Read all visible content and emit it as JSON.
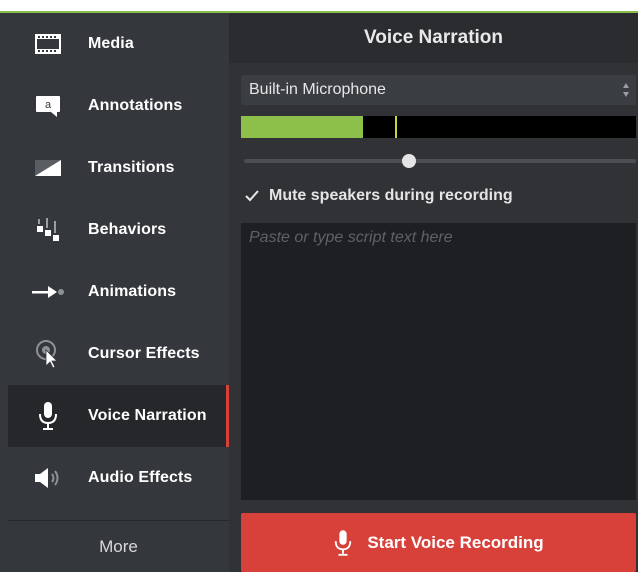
{
  "sidebar": {
    "items": [
      {
        "label": "Media",
        "icon": "film-strip-icon"
      },
      {
        "label": "Annotations",
        "icon": "speech-bubble-icon"
      },
      {
        "label": "Transitions",
        "icon": "transition-icon"
      },
      {
        "label": "Behaviors",
        "icon": "behaviors-icon"
      },
      {
        "label": "Animations",
        "icon": "arrow-animation-icon"
      },
      {
        "label": "Cursor Effects",
        "icon": "cursor-effects-icon"
      },
      {
        "label": "Voice Narration",
        "icon": "microphone-icon",
        "active": true
      },
      {
        "label": "Audio Effects",
        "icon": "speaker-icon"
      }
    ],
    "more_label": "More"
  },
  "panel": {
    "title": "Voice Narration",
    "device": {
      "selected": "Built-in Microphone"
    },
    "level_meter": {
      "level": 0.31,
      "peak": 0.39,
      "color": "#8dc04b"
    },
    "volume": {
      "value": 0.42
    },
    "mute_speakers": {
      "label": "Mute speakers during recording",
      "checked": true
    },
    "script": {
      "value": "",
      "placeholder": "Paste or type script text here"
    },
    "record_button": {
      "label": "Start Voice Recording",
      "color": "#d8403a"
    }
  },
  "colors": {
    "accent_green": "#8bbd4b",
    "active_indicator": "#d9403a"
  }
}
